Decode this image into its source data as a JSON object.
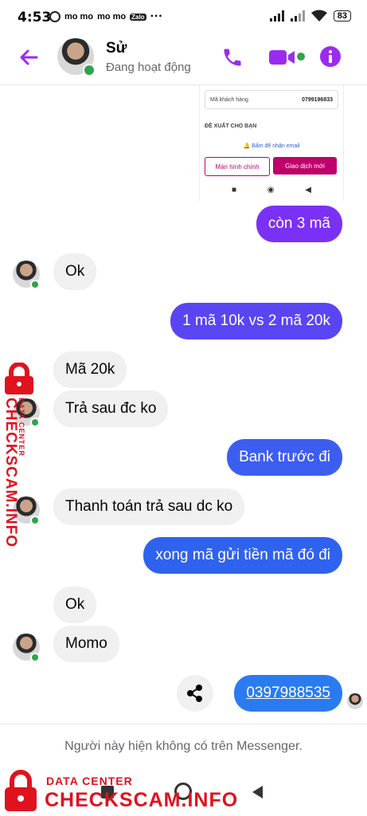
{
  "status_bar": {
    "time": "4:53",
    "app_icons": [
      "mo mo",
      "mo mo",
      "Zalo"
    ],
    "more": "···",
    "battery": "83"
  },
  "header": {
    "name": "Sử",
    "status": "Đang hoạt động"
  },
  "screenshot": {
    "field_label": "Mã khách hàng",
    "field_value": "0799196833",
    "section": "ĐỀ XUẤT CHO BẠN",
    "email_text": "Bấm để nhận email",
    "btn_home": "Màn hình chính",
    "btn_new": "Giao dịch mới",
    "nav": [
      "■",
      "◉",
      "◀"
    ]
  },
  "messages": [
    {
      "text": "còn 3 mã"
    },
    {
      "text": "Ok"
    },
    {
      "text": "1 mã 10k vs 2 mã 20k"
    },
    {
      "text": "Mã 20k"
    },
    {
      "text": "Trả sau đc ko"
    },
    {
      "text": "Bank trước đi"
    },
    {
      "text": "Thanh toán trả sau dc ko"
    },
    {
      "text": "xong mã gửi tiền mã đó đi"
    },
    {
      "text": "Ok"
    },
    {
      "text": "Momo"
    },
    {
      "text": "0397988535"
    }
  ],
  "footer_text": "Người này hiện không có trên Messenger.",
  "watermark": {
    "top": "DATA CENTER",
    "main": "CHECKSCAM.INFO"
  },
  "colors": {
    "accent": "#9b2bf0",
    "bubble_purple": "#7b30f5",
    "bubble_blue": "#3c5ef0",
    "incoming": "#f0f0f0",
    "online": "#31a24c",
    "watermark": "#e0121d"
  }
}
